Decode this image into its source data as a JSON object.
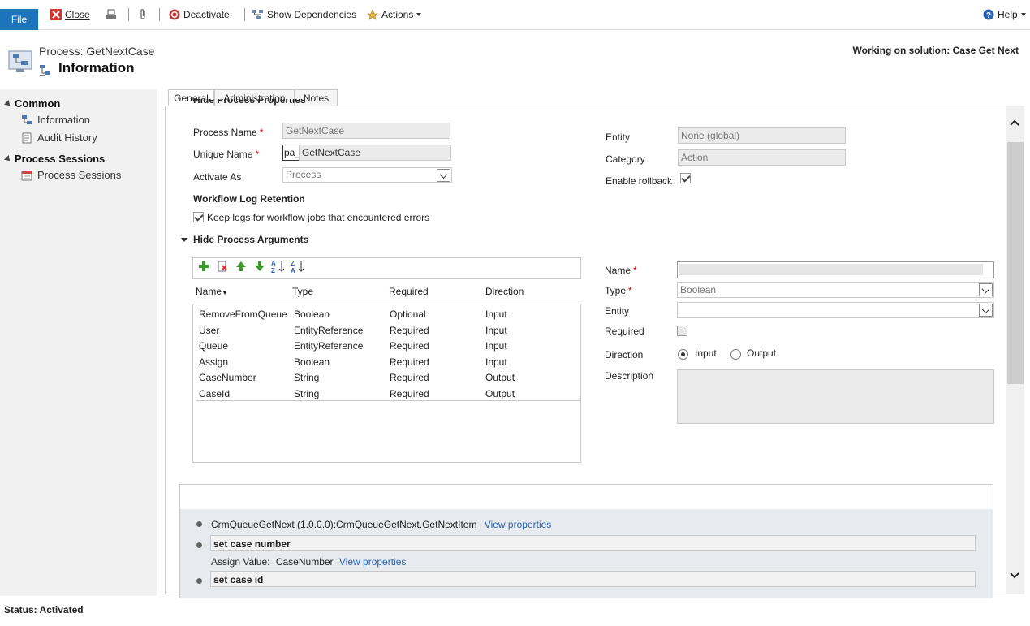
{
  "toolbar": {
    "file": "File",
    "close": "Close",
    "deactivate": "Deactivate",
    "show_dependencies": "Show Dependencies",
    "actions": "Actions",
    "help": "Help"
  },
  "header": {
    "process_title": "Process: GetNextCase",
    "page_title": "Information",
    "solution": "Working on solution: Case Get Next"
  },
  "nav": {
    "groups": [
      {
        "label": "Common",
        "items": [
          "Information",
          "Audit History"
        ]
      },
      {
        "label": "Process Sessions",
        "items": [
          "Process Sessions"
        ]
      }
    ]
  },
  "tabs": [
    "General",
    "Administration",
    "Notes"
  ],
  "form": {
    "cut_heading": "Hide Process Properties",
    "process_name_label": "Process Name",
    "process_name_value": "GetNextCase",
    "unique_name_label": "Unique Name",
    "unique_name_prefix": "pa_",
    "unique_name_value": "GetNextCase",
    "activate_as_label": "Activate As",
    "activate_as_value": "Process",
    "entity_label": "Entity",
    "entity_value": "None (global)",
    "category_label": "Category",
    "category_value": "Action",
    "enable_rollback_label": "Enable rollback",
    "log_retention_heading": "Workflow Log Retention",
    "keep_logs_label": "Keep logs for workflow jobs that encountered errors",
    "args_heading": "Hide Process Arguments"
  },
  "args_grid": {
    "headers": [
      "Name",
      "Type",
      "Required",
      "Direction"
    ],
    "rows": [
      [
        "RemoveFromQueue",
        "Boolean",
        "Optional",
        "Input"
      ],
      [
        "User",
        "EntityReference",
        "Required",
        "Input"
      ],
      [
        "Queue",
        "EntityReference",
        "Required",
        "Input"
      ],
      [
        "Assign",
        "Boolean",
        "Required",
        "Input"
      ],
      [
        "CaseNumber",
        "String",
        "Required",
        "Output"
      ],
      [
        "CaseId",
        "String",
        "Required",
        "Output"
      ]
    ]
  },
  "arg_detail": {
    "name_label": "Name",
    "type_label": "Type",
    "type_value": "Boolean",
    "entity_label": "Entity",
    "required_label": "Required",
    "direction_label": "Direction",
    "input": "Input",
    "output": "Output",
    "description_label": "Description"
  },
  "steps": {
    "step1": "CrmQueueGetNext (1.0.0.0):CrmQueueGetNext.GetNextItem",
    "view_properties": "View properties",
    "step2": "set case number",
    "assign_label": "Assign Value:",
    "assign_value": "CaseNumber",
    "step3": "set case id"
  },
  "status": "Status: Activated"
}
